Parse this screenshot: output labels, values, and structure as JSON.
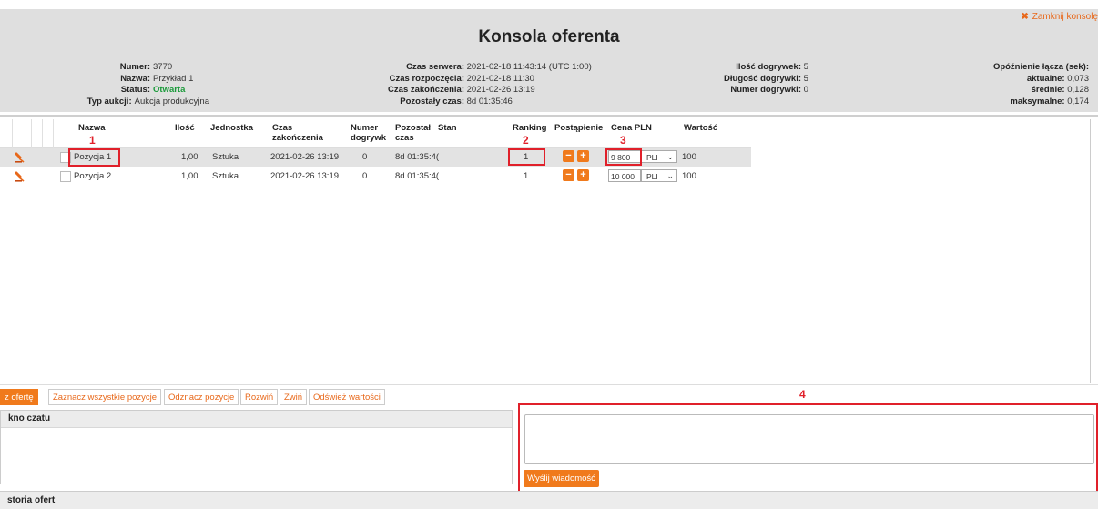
{
  "title": "Konsola oferenta",
  "close_label": "Zamknij konsolę",
  "info": {
    "numer_k": "Numer:",
    "numer_v": "3770",
    "nazwa_k": "Nazwa:",
    "nazwa_v": "Przykład 1",
    "status_k": "Status:",
    "status_v": "Otwarta",
    "typ_k": "Typ aukcji:",
    "typ_v": "Aukcja produkcyjna",
    "czas_serwera_k": "Czas serwera:",
    "czas_serwera_v": "2021-02-18 11:43:14 (UTC 1:00)",
    "czas_rozp_k": "Czas rozpoczęcia:",
    "czas_rozp_v": "2021-02-18 11:30",
    "czas_zak_k": "Czas zakończenia:",
    "czas_zak_v": "2021-02-26 13:19",
    "pozostaly_k": "Pozostały czas:",
    "pozostaly_v": "8d 01:35:46",
    "ilosc_dog_k": "Ilość dogrywek:",
    "ilosc_dog_v": "5",
    "dlugosc_dog_k": "Długość dogrywki:",
    "dlugosc_dog_v": "5",
    "numer_dog_k": "Numer dogrywki:",
    "numer_dog_v": "0",
    "opoznienie_k": "Opóźnienie łącza (sek):",
    "aktualne_k": "aktualne:",
    "aktualne_v": "0,073",
    "srednie_k": "średnie:",
    "srednie_v": "0,128",
    "maks_k": "maksymalne:",
    "maks_v": "0,174"
  },
  "columns": {
    "nazwa": "Nazwa",
    "ilosc": "Ilość",
    "jednostka": "Jednostka",
    "czas1": "Czas",
    "czas2": "zakończenia",
    "numer1": "Numer",
    "numer2": "dogrywk",
    "pozostal1": "Pozostał",
    "pozostal2": "czas",
    "stan": "Stan",
    "ranking": "Ranking",
    "postapienie": "Postąpienie",
    "cena": "Cena PLN",
    "wartosc": "Wartość"
  },
  "rows": [
    {
      "nazwa": "Pozycja 1",
      "ilosc": "1,00",
      "jednostka": "Sztuka",
      "czas": "2021-02-26 13:19",
      "numer": "0",
      "pozostaly": "8d 01:35:4(",
      "ranking": "1",
      "cena": "9 800",
      "waluta": "PLI",
      "wartosc": "100"
    },
    {
      "nazwa": "Pozycja 2",
      "ilosc": "1,00",
      "jednostka": "Sztuka",
      "czas": "2021-02-26 13:19",
      "numer": "0",
      "pozostaly": "8d 01:35:4(",
      "ranking": "1",
      "cena": "10 000",
      "waluta": "PLI",
      "wartosc": "100"
    }
  ],
  "annotations": {
    "n1": "1",
    "n2": "2",
    "n3": "3",
    "n4": "4"
  },
  "toolbar": {
    "b0": "z ofertę",
    "b1": "Zaznacz wszystkie pozycje",
    "b2": "Odznacz pozycje",
    "b3": "Rozwiń",
    "b4": "Zwiń",
    "b5": "Odśwież wartości"
  },
  "chat_title": "kno czatu",
  "send_label": "Wyślij wiadomość",
  "history_title": "storia ofert",
  "colors": {
    "accent": "#f07a1c",
    "annotation": "#e0202a",
    "status_open": "#1a9a3a"
  }
}
